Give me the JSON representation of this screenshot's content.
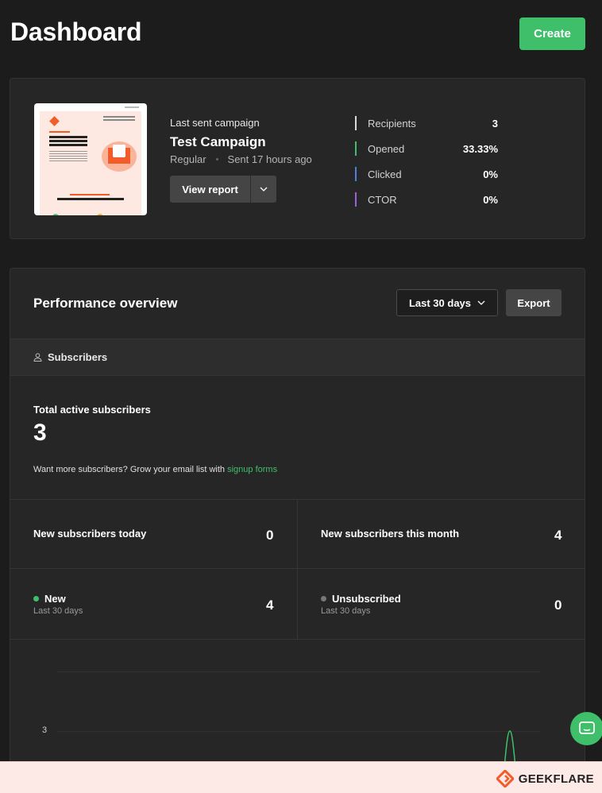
{
  "header": {
    "title": "Dashboard",
    "create_label": "Create"
  },
  "campaign": {
    "label": "Last sent campaign",
    "name": "Test Campaign",
    "type": "Regular",
    "sent": "Sent 17 hours ago",
    "view_report_label": "View report",
    "stats": [
      {
        "label": "Recipients",
        "value": "3",
        "color": "#d9d9d9"
      },
      {
        "label": "Opened",
        "value": "33.33%",
        "color": "#3fbf6a"
      },
      {
        "label": "Clicked",
        "value": "0%",
        "color": "#4d7fe0"
      },
      {
        "label": "CTOR",
        "value": "0%",
        "color": "#a05fe0"
      }
    ]
  },
  "performance": {
    "title": "Performance overview",
    "range_label": "Last 30 days",
    "export_label": "Export",
    "tab_label": "Subscribers",
    "total_label": "Total active subscribers",
    "total_value": "3",
    "grow_text": "Want more subscribers? Grow your email list with ",
    "grow_link": "signup forms",
    "new_today_label": "New subscribers today",
    "new_today_value": "0",
    "new_month_label": "New subscribers this month",
    "new_month_value": "4",
    "new_label": "New",
    "new_sub": "Last 30 days",
    "new_value": "4",
    "unsub_label": "Unsubscribed",
    "unsub_sub": "Last 30 days",
    "unsub_value": "0",
    "new_color": "#3fbf6a",
    "unsub_color": "#777777"
  },
  "chart_data": {
    "type": "line",
    "y_ticks": [
      "3"
    ],
    "series": [
      {
        "values": [
          0,
          0,
          0,
          3,
          0
        ],
        "color": "#3fbf6a"
      }
    ]
  },
  "footer": {
    "brand": "GEEKFLARE"
  },
  "colors": {
    "accent": "#3fbf6a",
    "background": "#1c1c1c",
    "card": "#262626"
  }
}
